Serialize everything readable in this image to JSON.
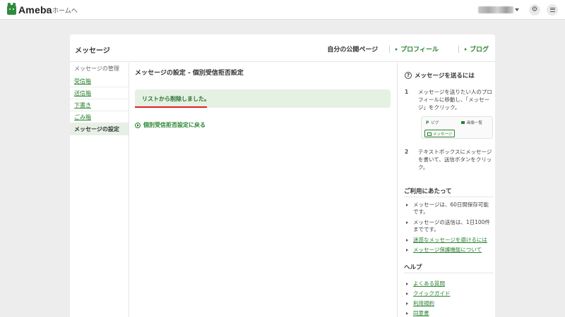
{
  "topbar": {
    "logo_text": "Ameba",
    "home_link": "ホームへ"
  },
  "card": {
    "title": "メッセージ",
    "header_links": {
      "own_page": "自分の公開ページ",
      "profile": "プロフィール",
      "blog": "ブログ"
    }
  },
  "sidebar": {
    "heading": "メッセージの管理",
    "items": [
      {
        "label": "受信箱"
      },
      {
        "label": "送信箱"
      },
      {
        "label": "下書き"
      },
      {
        "label": "ごみ箱"
      },
      {
        "label": "メッセージの設定",
        "active": true
      }
    ]
  },
  "main": {
    "title": "メッセージの設定 - 個別受信拒否設定",
    "notice": "リストから削除しました。",
    "back_link": "個別受信拒否設定に戻る"
  },
  "right_panel": {
    "send_title": "メッセージを送るには",
    "steps": [
      {
        "num": "1",
        "text": "メッセージを送りたい人のプロフィールに移動し、「メッセージ」をクリック。"
      },
      {
        "num": "2",
        "text": "テキストボックスにメッセージを書いて、送信ボタンをクリック。"
      }
    ],
    "step_image": {
      "pigg": "ピグ",
      "album": "画像一覧",
      "message_button": "メッセージ"
    },
    "usage_title": "ご利用にあたって",
    "usage_items": [
      {
        "text": "メッセージは、60日間保存可能です。",
        "link": false
      },
      {
        "text": "メッセージの送信は、1日100件までです。",
        "link": false
      },
      {
        "text": "迷惑なメッセージを避けるには",
        "link": true
      },
      {
        "text": "メッセージ保護機能について",
        "link": true
      }
    ],
    "help_title": "ヘルプ",
    "help_items": [
      {
        "text": "よくある質問"
      },
      {
        "text": "クイックガイド"
      },
      {
        "text": "利用規約"
      },
      {
        "text": "同意書"
      }
    ]
  },
  "colors": {
    "accent_green": "#28822e",
    "notice_bg": "#e5f1e3",
    "highlight_red": "#e02020"
  }
}
